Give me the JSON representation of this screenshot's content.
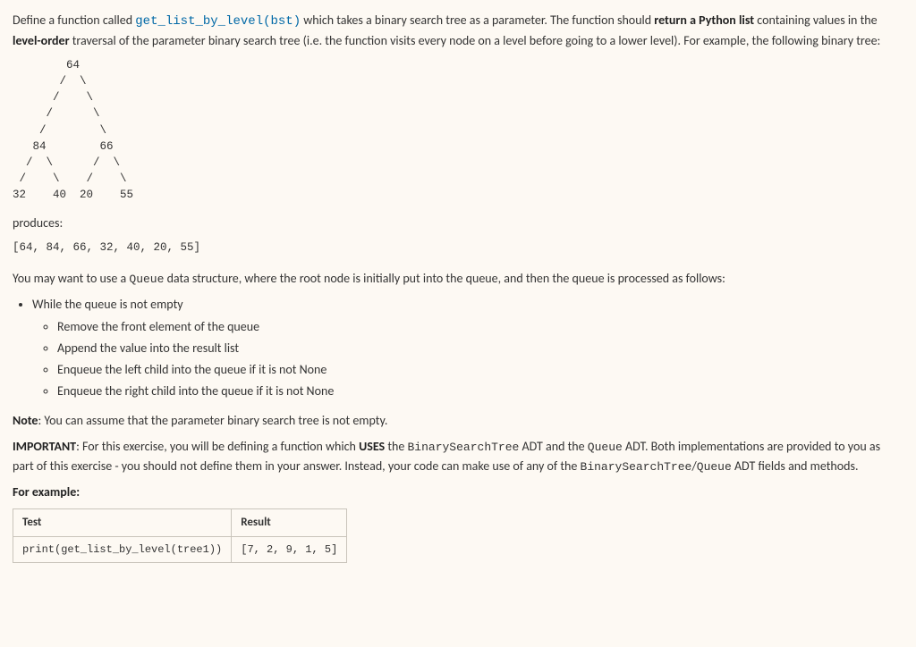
{
  "intro": {
    "pre_fn": "Define a function called ",
    "fn": "get_list_by_level(bst)",
    "post_fn_1": " which takes a binary search tree as a parameter. The function should ",
    "bold1": "return a Python list",
    "post_bold1": " containing values in the ",
    "bold2": "level-order",
    "post_bold2": " traversal of the parameter binary search tree (i.e. the function visits every node on a level before going to a lower level). For example, the following binary tree:"
  },
  "tree": "        64\n       /  \\\n      /    \\\n     /      \\\n    /        \\\n   84        66\n  /  \\      /  \\\n /    \\    /    \\\n32    40  20    55",
  "produces_label": "produces:",
  "produces_output": "[64, 84, 66, 32, 40, 20, 55]",
  "queue_para": {
    "pre": "You may want to use a ",
    "code": "Queue",
    "post": " data structure, where the root node is initially put into the queue, and then the queue is processed as follows:"
  },
  "algo": {
    "outer": "While the queue is not empty",
    "steps": [
      "Remove the front element of the queue",
      "Append the value into the result list",
      "Enqueue the left child into the queue if it is not None",
      "Enqueue the right child into the queue if it is not None"
    ]
  },
  "note": {
    "label": "Note",
    "text": ": You can assume that the parameter binary search tree is not empty."
  },
  "important": {
    "label": "IMPORTANT",
    "pre": ": For this exercise, you will be defining a function which ",
    "uses": "USES",
    "post_uses": " the ",
    "adt1": "BinarySearchTree",
    "mid1": " ADT and the ",
    "adt2": "Queue",
    "post_adt2": " ADT. Both implementations are provided to you as part of this exercise - you should not define them in your answer. Instead, your code can make use of any of the ",
    "adt3": "BinarySearchTree",
    "slash": "/",
    "adt4": "Queue",
    "tail": " ADT fields and methods."
  },
  "example_label": "For example:",
  "table": {
    "head_test": "Test",
    "head_result": "Result",
    "row_test": "print(get_list_by_level(tree1))",
    "row_result": "[7, 2, 9, 1, 5]"
  }
}
